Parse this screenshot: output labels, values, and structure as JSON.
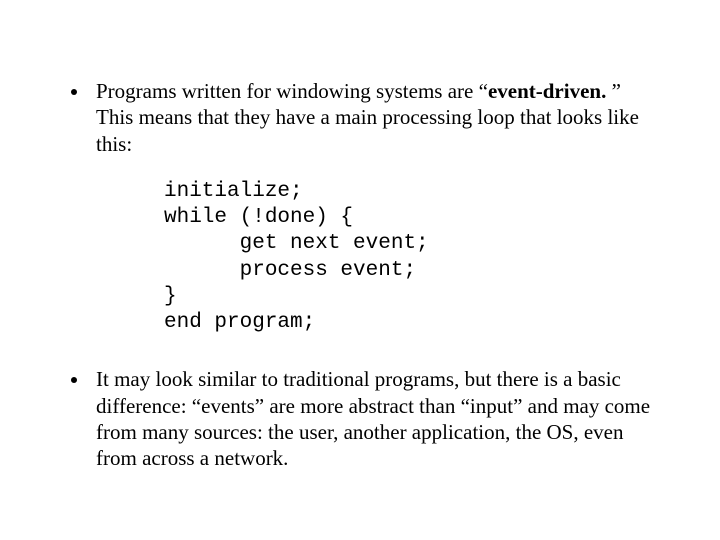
{
  "bullet1": {
    "pre": "Programs written for windowing systems are “",
    "bold": "event-driven.",
    "post": " ”  This means that they have a main processing loop that looks like this:"
  },
  "code": "initialize;\nwhile (!done) {\n      get next event;\n      process event;\n}\nend program;",
  "bullet2": "It may look similar to traditional programs, but there is a basic difference:  “events” are more abstract than “input” and may come from many sources:  the user, another application, the OS, even from across a network."
}
